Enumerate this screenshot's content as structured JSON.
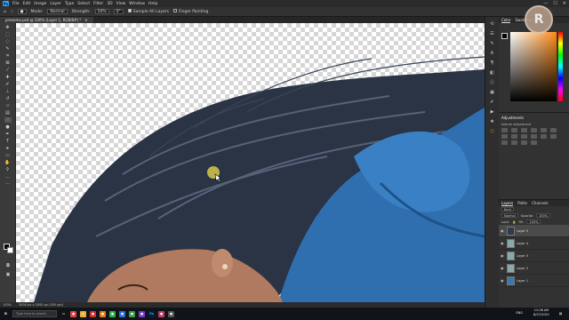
{
  "app": {
    "logo_text": "Ps"
  },
  "menu": [
    "File",
    "Edit",
    "Image",
    "Layer",
    "Type",
    "Select",
    "Filter",
    "3D",
    "View",
    "Window",
    "Help"
  ],
  "window_controls": [
    "—",
    "☐",
    "✕"
  ],
  "options_bar": {
    "mode_label": "Mode:",
    "mode_value": "Normal",
    "strength_label": "Strength:",
    "strength_value": "50%",
    "angle_value": "0°",
    "sample_all_layers": "Sample All Layers",
    "finger_painting": "Finger Painting"
  },
  "document_tab": {
    "title": "preeema.psd @ 100% (Layer 1, RGB/8#) *",
    "close": "✕"
  },
  "status_bar": {
    "zoom": "100%",
    "doc_info": "3000 px x 2000 px (300 ppi)"
  },
  "panels": {
    "color_tabs": [
      "Color",
      "Swatches"
    ],
    "adjustments_title": "Adjustments",
    "adjustments_subtitle": "Add an adjustment",
    "layers_tabs": [
      "Layers",
      "Paths",
      "Channels"
    ],
    "kind_label": "Kind",
    "blend_mode": "Normal",
    "opacity_label": "Opacity:",
    "opacity_value": "100%",
    "lock_label": "Lock:",
    "fill_label": "Fill:",
    "fill_value": "100%",
    "layers": [
      {
        "name": "Layer 5",
        "selected": true,
        "thumb": "hair"
      },
      {
        "name": "Layer 4",
        "selected": false,
        "thumb": "plain"
      },
      {
        "name": "Layer 3",
        "selected": false,
        "thumb": "plain"
      },
      {
        "name": "Layer 2",
        "selected": false,
        "thumb": "plain"
      },
      {
        "name": "Layer 1",
        "selected": false,
        "thumb": "blue"
      }
    ]
  },
  "taskbar": {
    "search_placeholder": "Type here to search",
    "lang": "ENG",
    "time": "11:08 AM",
    "date": "8/27/2021"
  },
  "watermark": {
    "letter": "R"
  },
  "colors": {
    "accent": "#31a8ff",
    "shirt": "#2f6fb0",
    "hair": "#2a3444"
  }
}
